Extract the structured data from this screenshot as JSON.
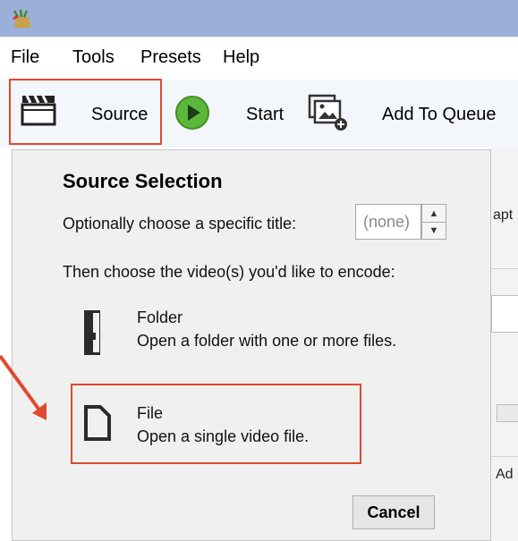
{
  "menu": [
    "File",
    "Tools",
    "Presets",
    "Help"
  ],
  "toolbar": {
    "source_label": "Source",
    "start_label": "Start",
    "add_queue_label": "Add To Queue"
  },
  "background": {
    "top_partial": "apt",
    "bottom_partial": "Ad"
  },
  "popup": {
    "title": "Source Selection",
    "title_prompt": "Optionally choose a specific title:",
    "title_value": "(none)",
    "encode_prompt": "Then choose the video(s) you'd like to encode:",
    "folder": {
      "title": "Folder",
      "description": "Open a folder with one or more files."
    },
    "file": {
      "title": "File",
      "description": "Open a single video file."
    },
    "cancel_label": "Cancel"
  },
  "colors": {
    "highlight": "#e0482e",
    "titlebar": "#9bb0d8",
    "start_green": "#5cb83a"
  }
}
